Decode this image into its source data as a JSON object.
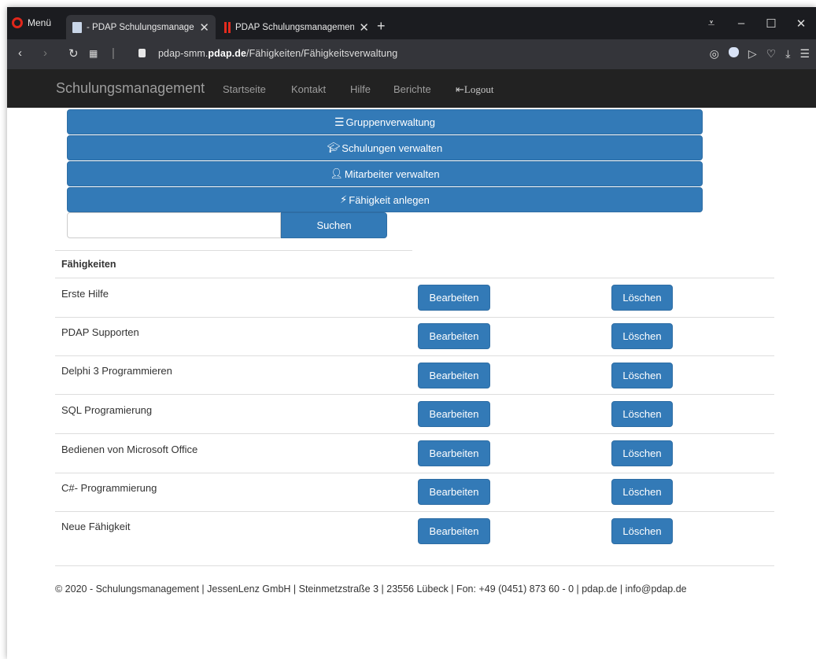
{
  "browser": {
    "menu_label": "Menü",
    "tabs": [
      {
        "title": "- PDAP Schulungsmanagement"
      },
      {
        "title": "PDAP Schulungsmanagement"
      }
    ],
    "url_prefix": "pdap-smm.",
    "url_domain": "pdap.de",
    "url_path": "/Fähigkeiten/Fähigkeitsverwaltung"
  },
  "navbar": {
    "brand": "Schulungsmanagement",
    "links": [
      "Startseite",
      "Kontakt",
      "Hilfe",
      "Berichte"
    ],
    "logout": "Logout"
  },
  "actions": [
    {
      "label": "Gruppenverwaltung",
      "icon": "list-icon"
    },
    {
      "label": "Schulungen verwalten",
      "icon": "graduation-cap-icon"
    },
    {
      "label": "Mitarbeiter verwalten",
      "icon": "user-icon"
    },
    {
      "label": "Fähigkeit anlegen",
      "icon": "flash-icon"
    }
  ],
  "search": {
    "value": "",
    "button_label": "Suchen"
  },
  "table": {
    "header": "Fähigkeiten",
    "edit_label": "Bearbeiten",
    "delete_label": "Löschen",
    "rows": [
      "Erste Hilfe",
      "PDAP Supporten",
      "Delphi 3 Programmieren",
      "SQL Programierung",
      "Bedienen von Microsoft Office",
      "C#- Programmierung",
      "Neue Fähigkeit"
    ]
  },
  "footer": "© 2020 - Schulungsmanagement | JessenLenz GmbH | Steinmetzstraße 3 | 23556 Lübeck | Fon: +49 (0451) 873 60 - 0 | pdap.de | info@pdap.de",
  "colors": {
    "primary": "#337ab7",
    "navbar": "#222222",
    "browser_chrome": "#1b1c20"
  }
}
